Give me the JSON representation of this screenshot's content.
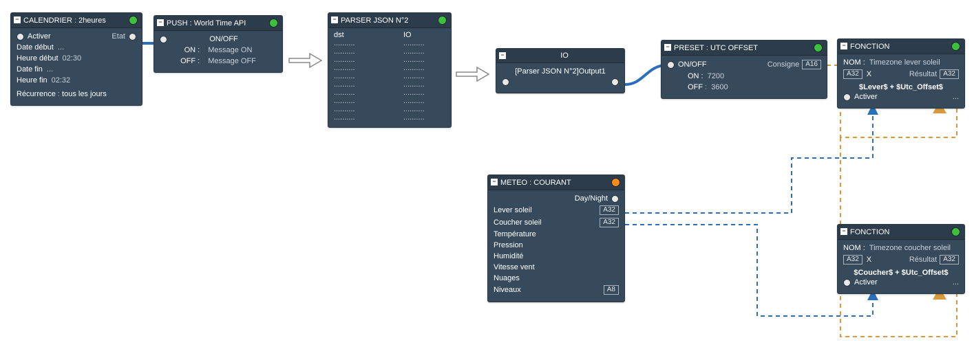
{
  "calendrier": {
    "title": "CALENDRIER : 2heures",
    "activer": "Activer",
    "etat": "Etat",
    "date_debut_label": "Date début",
    "date_debut_val": "...",
    "heure_debut_label": "Heure début",
    "heure_debut_val": "02:30",
    "date_fin_label": "Date fin",
    "date_fin_val": "...",
    "heure_fin_label": "Heure fin",
    "heure_fin_val": "02:32",
    "recurrence": "Récurrence : tous les jours"
  },
  "push": {
    "title": "PUSH : World Time API",
    "onoff": "ON/OFF",
    "on_label": "ON :",
    "on_val": "Message ON",
    "off_label": "OFF :",
    "off_val": "Message OFF"
  },
  "parser": {
    "title": "PARSER JSON N°2",
    "dst_header": "dst",
    "io_header": "IO",
    "row_placeholder": ".........."
  },
  "io": {
    "title": "IO",
    "ref": "[Parser JSON N°2]Output1"
  },
  "preset": {
    "title": "PRESET : UTC OFFSET",
    "onoff": "ON/OFF",
    "consigne": "Consigne",
    "consigne_val": "A16",
    "on_label": "ON :",
    "on_val": "7200",
    "off_label": "OFF :",
    "off_val": "3600"
  },
  "meteo": {
    "title": "METEO : COURANT",
    "daynight": "Day/Night",
    "lever_label": "Lever soleil",
    "lever_val": "A32",
    "coucher_label": "Coucher soleil",
    "coucher_val": "A32",
    "temp_label": "Température",
    "pression_label": "Pression",
    "humidite_label": "Humidité",
    "vent_label": "Vitesse vent",
    "nuages_label": "Nuages",
    "niveaux_label": "Niveaux",
    "niveaux_val": "A8"
  },
  "fonction1": {
    "title": "FONCTION",
    "nom_label": "NOM :",
    "nom_val": "Timezone lever soleil",
    "x_label": "X",
    "x_val": "A32",
    "resultat_label": "Résultat",
    "resultat_val": "A32",
    "formula": "$Lever$ + $Utc_Offset$",
    "activer": "Activer",
    "dots": "..."
  },
  "fonction2": {
    "title": "FONCTION",
    "nom_label": "NOM :",
    "nom_val": "Timezone coucher soleil",
    "x_label": "X",
    "x_val": "A32",
    "resultat_label": "Résultat",
    "resultat_val": "A32",
    "formula": "$Coucher$ + $Utc_Offset$",
    "activer": "Activer",
    "dots": "..."
  },
  "colors": {
    "node_bg": "#374a5c",
    "green": "#3dc13d",
    "orange": "#ff8c1a",
    "wire_blue": "#2b6fbb",
    "wire_orange": "#d99a3e"
  }
}
